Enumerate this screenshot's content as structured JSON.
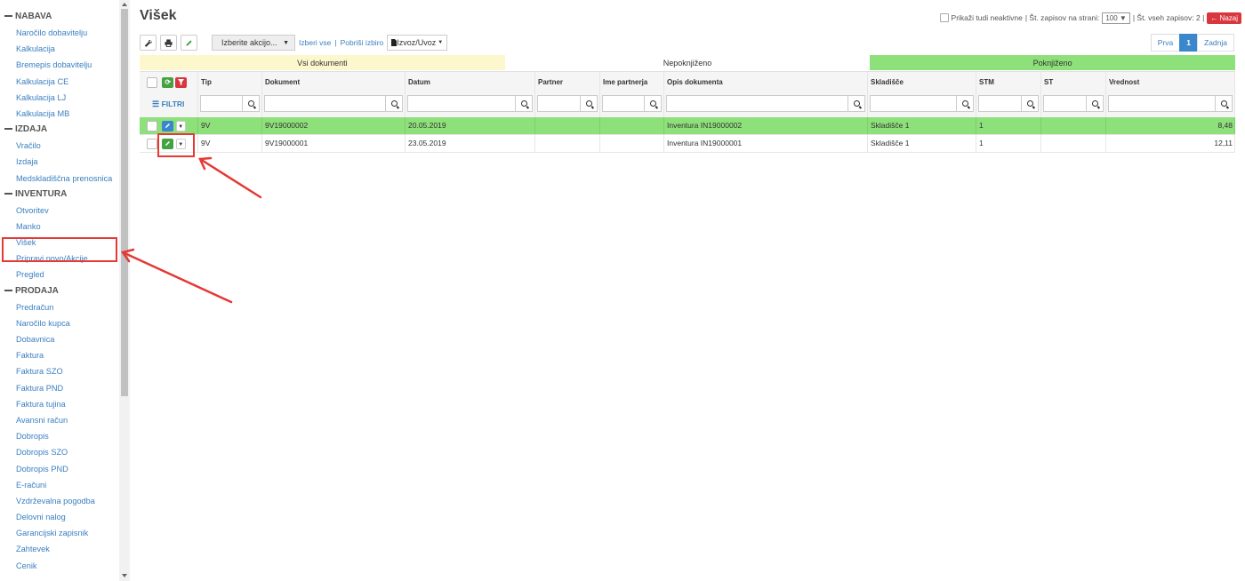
{
  "sidebar": {
    "sections": [
      {
        "title": "NABAVA",
        "items": [
          "Naročilo dobavitelju",
          "Kalkulacija",
          "Bremepis dobavitelju",
          "Kalkulacija CE",
          "Kalkulacija LJ",
          "Kalkulacija MB"
        ]
      },
      {
        "title": "IZDAJA",
        "items": [
          "Vračilo",
          "Izdaja",
          "Medskladiščna prenosnica"
        ]
      },
      {
        "title": "INVENTURA",
        "items": [
          "Otvoritev",
          "Manko",
          "Višek",
          "Pripravi novo/Akcije",
          "Pregled"
        ]
      },
      {
        "title": "PRODAJA",
        "items": [
          "Predračun",
          "Naročilo kupca",
          "Dobavnica",
          "Faktura",
          "Faktura SZO",
          "Faktura PND",
          "Faktura tujina",
          "Avansni račun",
          "Dobropis",
          "Dobropis SZO",
          "Dobropis PND",
          "E-računi",
          "Vzdrževalna pogodba",
          "Delovni nalog",
          "Garancijski zapisnik",
          "Zahtevek",
          "Cenik"
        ]
      }
    ]
  },
  "page": {
    "title": "Višek"
  },
  "top_right": {
    "show_inactive": "Prikaži tudi neaktivne",
    "per_page_label": "| Št. zapisov na strani:",
    "per_page_value": "100 ▼",
    "total_label": "| Št. vseh zapisov: 2 |",
    "back_label": "Nazaj"
  },
  "toolbar": {
    "action_select": "Izberite akcijo...",
    "select_all": "Izberi vse",
    "sep": "|",
    "clear_selection": "Pobriši izbiro",
    "export": "Izvoz/Uvoz"
  },
  "pager": {
    "first": "Prva",
    "current": "1",
    "last": "Zadnja"
  },
  "status_bar": {
    "all": "Vsi dokumenti",
    "unposted": "Nepoknjiženo",
    "posted": "Poknjiženo"
  },
  "colors": {
    "all": "#fdf7cd",
    "unposted": "#ffffff",
    "posted": "#8ee07a",
    "edit_blue": "#3a87ce",
    "edit_green": "#44a340",
    "highlight": "#e53935"
  },
  "table": {
    "filters_label": "FILTRI",
    "columns": [
      "Tip",
      "Dokument",
      "Datum",
      "Partner",
      "Ime partnerja",
      "Opis dokumenta",
      "Skladišče",
      "STM",
      "ST",
      "Vrednost"
    ],
    "rows": [
      {
        "tip": "9V",
        "dokument": "9V19000002",
        "datum": "20.05.2019",
        "partner": "",
        "ime": "",
        "opis": "Inventura IN19000002",
        "skladisce": "Skladišče 1",
        "stm": "1",
        "st": "",
        "vrednost": "8,48"
      },
      {
        "tip": "9V",
        "dokument": "9V19000001",
        "datum": "23.05.2019",
        "partner": "",
        "ime": "",
        "opis": "Inventura IN19000001",
        "skladisce": "Skladišče 1",
        "stm": "1",
        "st": "",
        "vrednost": "12,11"
      }
    ]
  }
}
